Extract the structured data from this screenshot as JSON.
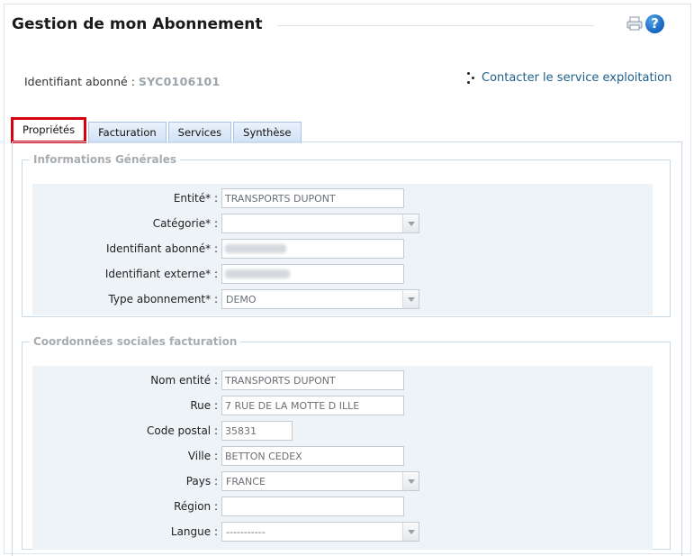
{
  "page": {
    "title": "Gestion de mon Abonnement",
    "subscriber_label": "Identifiant abonné :",
    "subscriber_value": "SYC0106101",
    "contact_link": "Contacter le service exploitation",
    "help_glyph": "?"
  },
  "icons": {
    "print": "print-icon",
    "help": "help-icon",
    "contact": "dots-icon"
  },
  "tabs": [
    {
      "label": "Propriétés",
      "active": true
    },
    {
      "label": "Facturation",
      "active": false
    },
    {
      "label": "Services",
      "active": false
    },
    {
      "label": "Synthèse",
      "active": false
    }
  ],
  "general": {
    "title": "Informations Générales",
    "entity_label": "Entité* :",
    "entity_value": "TRANSPORTS DUPONT",
    "category_label": "Catégorie* :",
    "category_value": "",
    "subscriber_id_label": "Identifiant abonné* :",
    "external_id_label": "Identifiant externe* :",
    "type_label": "Type abonnement* :",
    "type_value": "DEMO"
  },
  "billing": {
    "title": "Coordonnées sociales facturation",
    "name_label": "Nom entité :",
    "name_value": "TRANSPORTS DUPONT",
    "street_label": "Rue :",
    "street_value": "7 RUE DE LA MOTTE D ILLE",
    "zip_label": "Code postal :",
    "zip_value": "35831",
    "city_label": "Ville :",
    "city_value": "BETTON CEDEX",
    "country_label": "Pays :",
    "country_value": "FRANCE",
    "region_label": "Région :",
    "region_value": "",
    "language_label": "Langue :",
    "language_value": "-----------"
  },
  "colors": {
    "accent": "#1f5f8b",
    "active_tab_border": "#d6000f",
    "tab_bg": "#cfe0f6",
    "group_bg": "#eef3f8"
  }
}
